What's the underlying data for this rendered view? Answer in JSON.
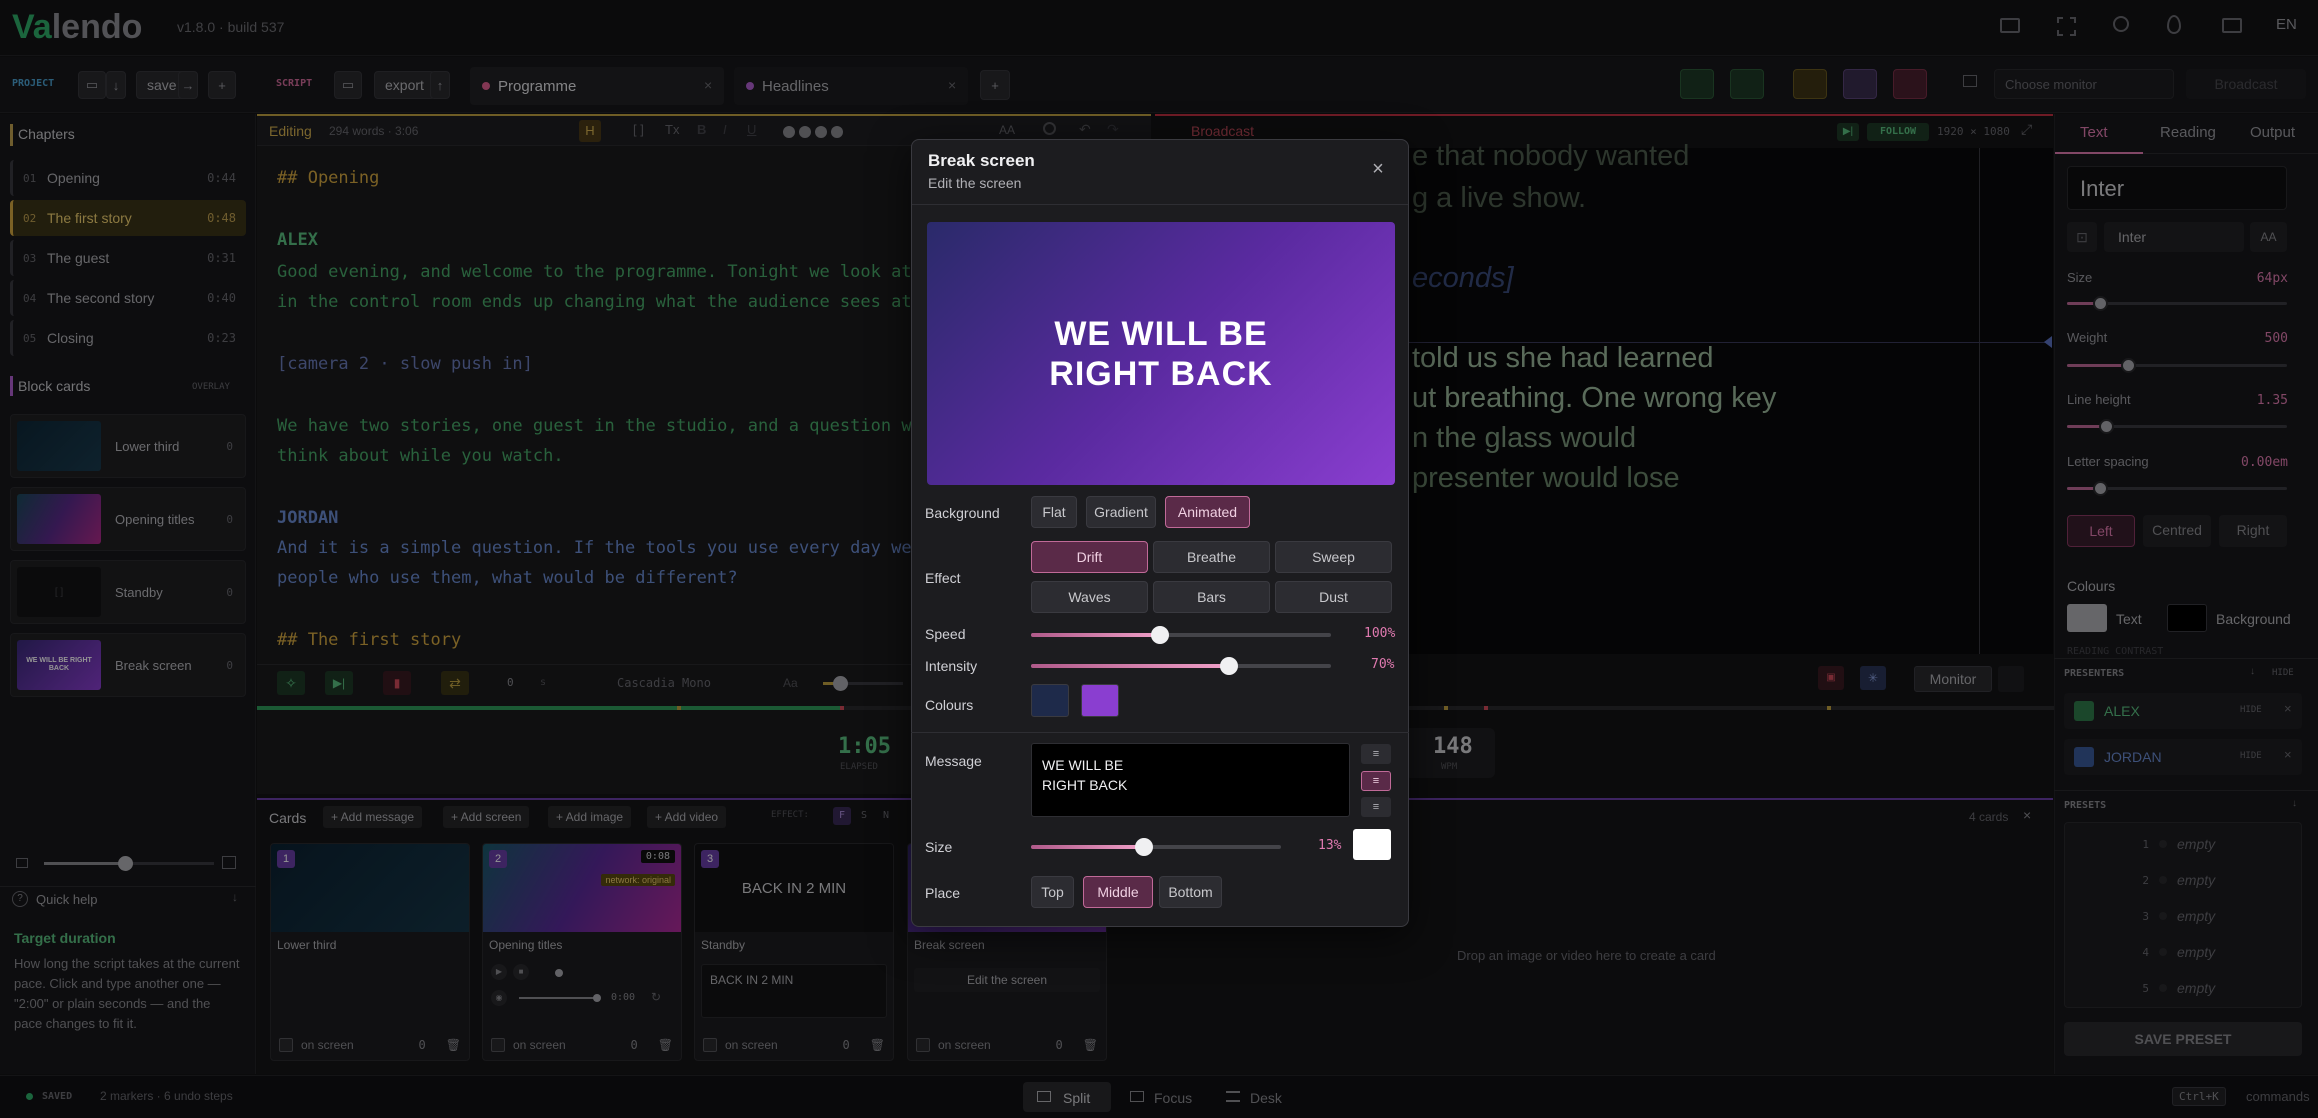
{
  "app": {
    "logo_a": "Va",
    "logo_b": "lendo",
    "version": "v1.8.0 · build 537",
    "lang": "EN"
  },
  "toolbar": {
    "project_label": "PROJECT",
    "save_label": "save",
    "script_label": "SCRIPT",
    "export_label": "export",
    "tabs": [
      {
        "label": "Programme",
        "color": "#e06090"
      },
      {
        "label": "Headlines",
        "color": "#b060d0"
      }
    ],
    "monitor_placeholder": "Choose monitor",
    "broadcast_label": "Broadcast"
  },
  "sidebar": {
    "chapters_title": "Chapters",
    "chapters": [
      {
        "num": "01",
        "title": "Opening",
        "dur": "0:44"
      },
      {
        "num": "02",
        "title": "The first story",
        "dur": "0:48"
      },
      {
        "num": "03",
        "title": "The guest",
        "dur": "0:31"
      },
      {
        "num": "04",
        "title": "The second story",
        "dur": "0:40"
      },
      {
        "num": "05",
        "title": "Closing",
        "dur": "0:23"
      }
    ],
    "blocks_title": "Block cards",
    "blocks_overlay": "OVERLAY",
    "blocks": [
      {
        "label": "Lower third",
        "count": "0"
      },
      {
        "label": "Opening titles",
        "count": "0"
      },
      {
        "label": "Standby",
        "count": "0"
      },
      {
        "label": "Break screen",
        "count": "0"
      }
    ],
    "break_thumb_text": "WE WILL BE RIGHT BACK",
    "quick_help": "Quick help",
    "help_title": "Target duration",
    "help_text": "How long the script takes at the current pace. Click and type another one — \"2:00\" or plain seconds — and the pace changes to fit it."
  },
  "editor": {
    "mode": "Editing",
    "stats": "294 words · 3:06",
    "lines": [
      {
        "text": "## Opening",
        "kind": "heading"
      },
      {
        "text": "ALEX",
        "kind": "speaker"
      },
      {
        "text": "Good evening, and welcome to the programme. Tonight we look at",
        "kind": "alex"
      },
      {
        "text": "in the control room ends up changing what the audience sees at",
        "kind": "alex"
      },
      {
        "text": "[camera 2 · slow push in]",
        "kind": "cue"
      },
      {
        "text": "We have two stories, one guest in the studio, and a question w",
        "kind": "alex"
      },
      {
        "text": "think about while you watch.",
        "kind": "alex"
      },
      {
        "text": "JORDAN",
        "kind": "speaker2"
      },
      {
        "text": "And it is a simple question. If the tools you use every day we",
        "kind": "jordan"
      },
      {
        "text": "people who use them, what would be different?",
        "kind": "jordan"
      },
      {
        "text": "## The first story",
        "kind": "heading"
      }
    ],
    "font": "Cascadia Mono",
    "font_size_label": "Aa",
    "counter": "0",
    "counter_unit": "s",
    "elapsed": "1:05",
    "elapsed_label": "ELAPSED",
    "wpm": "148",
    "wpm_label": "WPM"
  },
  "broadcast": {
    "title": "Broadcast",
    "follow": "FOLLOW",
    "resolution": "1920 × 1080",
    "lines": [
      "e that nobody wanted",
      "g a live show.",
      "econds]",
      "told us she had learned",
      "ut breathing. One wrong key",
      "n the glass would",
      "presenter would lose"
    ],
    "monitor_btn": "Monitor"
  },
  "cards": {
    "title": "Cards",
    "actions": [
      "+ Add message",
      "+ Add screen",
      "+ Add image",
      "+ Add video"
    ],
    "effect_label": "EFFECT:",
    "effect_keys": [
      "F",
      "S",
      "N"
    ],
    "count": "4 cards",
    "items": [
      {
        "num": "1",
        "label": "Lower third",
        "status": "on screen",
        "count": "0"
      },
      {
        "num": "2",
        "label": "Opening titles",
        "status": "on screen",
        "count": "0",
        "duration": "0:08",
        "badge": "network: original",
        "time": "0:00"
      },
      {
        "num": "3",
        "label": "Standby",
        "status": "on screen",
        "count": "0",
        "text": "BACK IN 2 MIN",
        "field": "BACK IN 2 MIN"
      },
      {
        "num": "",
        "label": "Break screen",
        "status": "on screen",
        "count": "0",
        "edit": "Edit the screen"
      }
    ],
    "drop_hint": "Drop an image or video here to create a card"
  },
  "right_panel": {
    "tabs": [
      "Text",
      "Reading",
      "Output"
    ],
    "font_name": "Inter",
    "font_select": "Inter",
    "aa": "AA",
    "size_label": "Size",
    "size_val": "64px",
    "size_frac": 0.15,
    "weight_label": "Weight",
    "weight_val": "500",
    "weight_frac": 0.28,
    "lh_label": "Line height",
    "lh_val": "1.35",
    "lh_frac": 0.18,
    "ls_label": "Letter spacing",
    "ls_val": "0.00em",
    "ls_frac": 0.15,
    "align": [
      "Left",
      "Centred",
      "Right"
    ],
    "colours_title": "Colours",
    "text_colour_label": "Text",
    "bg_colour_label": "Background",
    "reading_contrast": "READING CONTRAST",
    "presenters_title": "PRESENTERS",
    "hide_label": "HIDE",
    "presenters": [
      {
        "name": "ALEX",
        "color": "#2f7a4a"
      },
      {
        "name": "JORDAN",
        "color": "#3a5a9a"
      }
    ],
    "presets_title": "PRESETS",
    "presets": [
      {
        "n": "1",
        "v": "empty"
      },
      {
        "n": "2",
        "v": "empty"
      },
      {
        "n": "3",
        "v": "empty"
      },
      {
        "n": "4",
        "v": "empty"
      },
      {
        "n": "5",
        "v": "empty"
      }
    ],
    "save_preset": "SAVE PRESET"
  },
  "modal": {
    "title": "Break screen",
    "subtitle": "Edit the screen",
    "preview_text_1": "WE WILL BE",
    "preview_text_2": "RIGHT BACK",
    "background_label": "Background",
    "backgrounds": [
      "Flat",
      "Gradient",
      "Animated"
    ],
    "effect_label": "Effect",
    "effects": [
      "Drift",
      "Breathe",
      "Sweep",
      "Waves",
      "Bars",
      "Dust"
    ],
    "speed_label": "Speed",
    "speed_val": "100%",
    "speed_frac": 0.43,
    "intensity_label": "Intensity",
    "intensity_val": "70%",
    "intensity_frac": 0.66,
    "colours_label": "Colours",
    "colour_a": "#1e2a4a",
    "colour_b": "#8a3ed0",
    "message_label": "Message",
    "message_1": "WE WILL BE",
    "message_2": "RIGHT BACK",
    "size_label": "Size",
    "size_val": "13%",
    "size_frac": 0.45,
    "place_label": "Place",
    "places": [
      "Top",
      "Middle",
      "Bottom"
    ]
  },
  "statusbar": {
    "saved": "SAVED",
    "info": "2 markers · 6 undo steps",
    "modes": [
      "Split",
      "Focus",
      "Desk"
    ],
    "shortcut": "Ctrl+K",
    "commands": "commands"
  }
}
